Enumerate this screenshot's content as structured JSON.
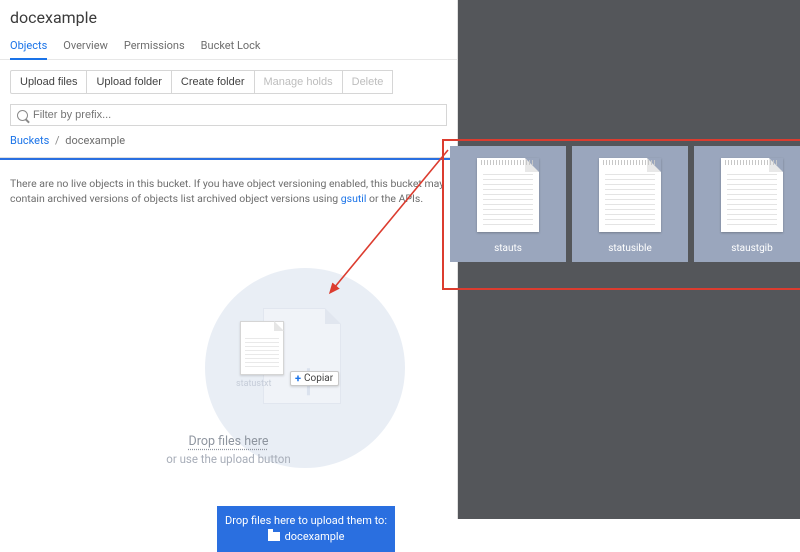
{
  "title": "docexample",
  "tabs": [
    {
      "label": "Objects",
      "active": true
    },
    {
      "label": "Overview",
      "active": false
    },
    {
      "label": "Permissions",
      "active": false
    },
    {
      "label": "Bucket Lock",
      "active": false
    }
  ],
  "toolbar": {
    "upload_files": "Upload files",
    "upload_folder": "Upload folder",
    "create_folder": "Create folder",
    "manage_holds": "Manage holds",
    "delete": "Delete"
  },
  "filter_placeholder": "Filter by prefix...",
  "breadcrumb": {
    "root": "Buckets",
    "sep": "/",
    "current": "docexample"
  },
  "empty_msg_1": "There are no live objects in this bucket. If you have object versioning enabled, this bucket may contain archived versions of objects list archived object versions using ",
  "empty_msg_link": "gsutil",
  "empty_msg_2": " or the APIs.",
  "copy_tag": "Copiar",
  "drag_caption": "statustxt",
  "drop_line1": "Drop files here",
  "drop_line2": "or use the upload button",
  "bluebox_line1": "Drop files here to upload them to:",
  "bluebox_target": "docexample",
  "files": [
    {
      "label": "stauts"
    },
    {
      "label": "statusible"
    },
    {
      "label": "staustgib"
    }
  ]
}
